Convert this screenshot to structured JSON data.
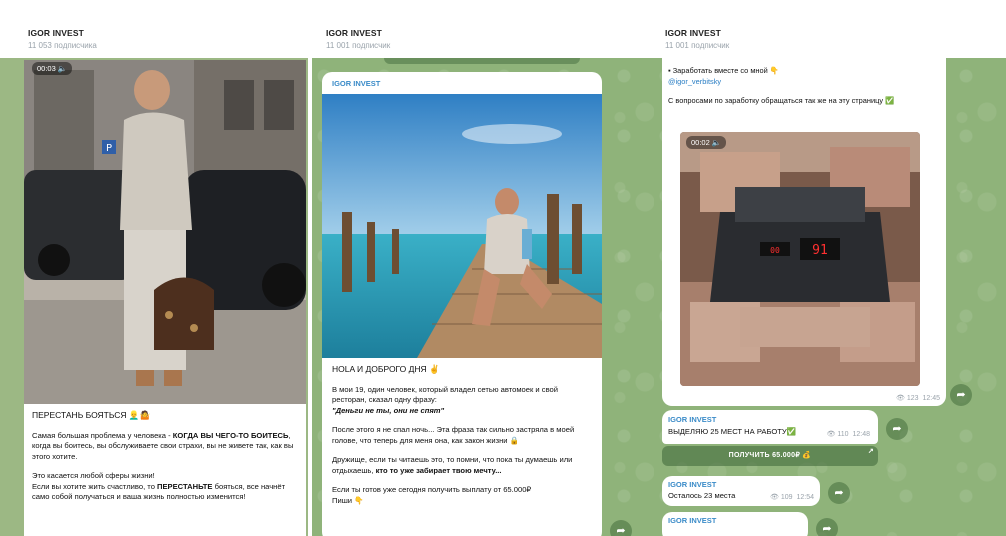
{
  "panel1": {
    "channel_title": "IGOR INVEST",
    "subscribers": "11 053 подписчика",
    "video_time": "00:03",
    "heading": "ПЕРЕСТАНЬ БОЯТЬСЯ 👱‍♂️🤷",
    "p1_pre": "Самая большая проблема у человека - ",
    "p1_bold": "КОГДА ВЫ ЧЕГО-ТО БОИТЕСЬ",
    "p1_post": ", когда вы боитесь, вы обслуживаете свои страхи, вы не живете так, как вы этого хотите.",
    "p2_line1": "Это касается любой сферы жизни!",
    "p2_pre": "Если вы хотите жить счастливо, то ",
    "p2_bold": "ПЕРЕСТАНЬТЕ",
    "p2_post": " бояться, все начнёт само собой получаться и ваша жизнь полностью изменится!"
  },
  "panel2": {
    "channel_title": "IGOR INVEST",
    "subscribers": "11 001 подписчик",
    "author": "IGOR INVEST",
    "heading": "HOLA И ДОБРОГО ДНЯ ✌️",
    "p1": "В мои 19, один человек, который владел сетью автомоек и свой ресторан, сказал одну фразу:",
    "p1_quote": "\"Деньги не ты, они не спят\"",
    "p2": "После этого я не спал ночь... Эта фраза так сильно застряла в моей голове, что теперь для меня она, как закон жизни 🔒",
    "p3_pre": "Дружище, если ты читаешь это, то помни, что пока ты думаешь или отдыхаешь, ",
    "p3_bold": "кто то уже забирает твою мечту...",
    "p4_line1": "Если ты готов уже сегодня получить выплату от 65.000₽",
    "p4_line2": "Пиши 👇"
  },
  "panel3": {
    "channel_title": "IGOR INVEST",
    "subscribers": "11 001 подписчик",
    "earn_text": "Заработать вместе со мной 👇",
    "earn_link": "@igor_verbitsky",
    "question_text": "С вопросами по заработку обращаться так же на эту страницу ✅",
    "video_time": "00:02",
    "video_views": "123",
    "video_time_sent": "12:45",
    "msg2_author": "IGOR INVEST",
    "msg2_text": "ВЫДЕЛЯЮ 25 МЕСТ НА РАБОТУ✅",
    "msg2_views": "110",
    "msg2_time": "12:48",
    "button_label": "ПОЛУЧИТЬ 65.000₽ 💰",
    "msg3_author": "IGOR INVEST",
    "msg3_text": "Осталось 23 места",
    "msg3_views": "109",
    "msg3_time": "12:54",
    "msg4_author": "IGOR INVEST"
  }
}
